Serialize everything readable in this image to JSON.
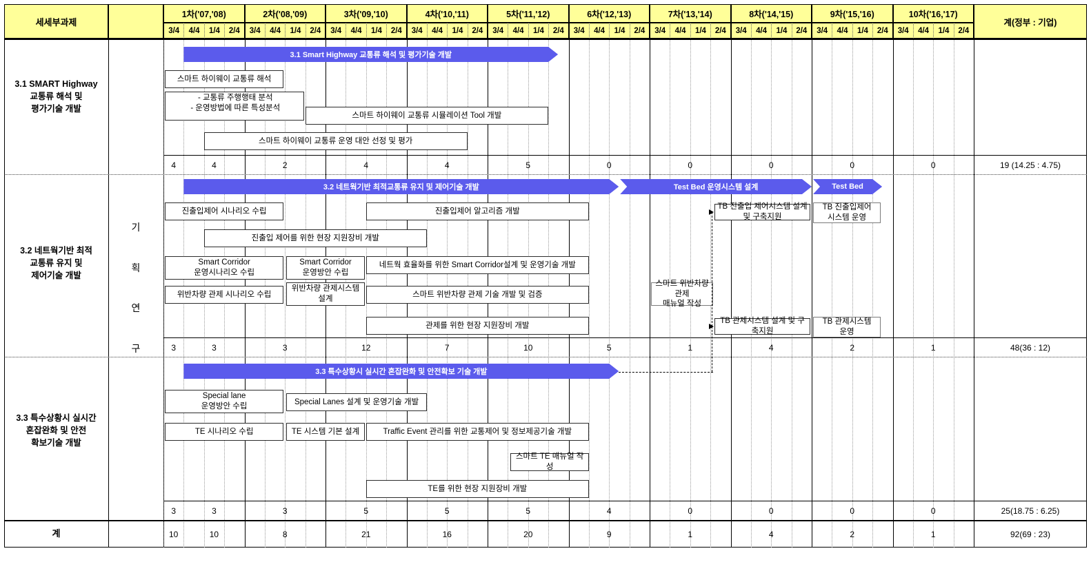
{
  "colors": {
    "header_bg": "#ffff99",
    "bar_blue": "#5b5bec",
    "box_bg": "#ffffff",
    "border": "#000000"
  },
  "header": {
    "task_column_label": "세세부과제",
    "total_column_label": "계(정부 : 기업)",
    "phases": [
      {
        "label": "1차('07,'08)",
        "quarters": [
          "3/4",
          "4/4",
          "1/4",
          "2/4"
        ]
      },
      {
        "label": "2차('08,'09)",
        "quarters": [
          "3/4",
          "4/4",
          "1/4",
          "2/4"
        ]
      },
      {
        "label": "3차('09,'10)",
        "quarters": [
          "3/4",
          "4/4",
          "1/4",
          "2/4"
        ]
      },
      {
        "label": "4차('10,'11)",
        "quarters": [
          "3/4",
          "4/4",
          "1/4",
          "2/4"
        ]
      },
      {
        "label": "5차('11,'12)",
        "quarters": [
          "3/4",
          "4/4",
          "1/4",
          "2/4"
        ]
      },
      {
        "label": "6차('12,'13)",
        "quarters": [
          "3/4",
          "4/4",
          "1/4",
          "2/4"
        ]
      },
      {
        "label": "7차('13,'14)",
        "quarters": [
          "3/4",
          "4/4",
          "1/4",
          "2/4"
        ]
      },
      {
        "label": "8차('14,'15)",
        "quarters": [
          "3/4",
          "4/4",
          "1/4",
          "2/4"
        ]
      },
      {
        "label": "9차('15,'16)",
        "quarters": [
          "3/4",
          "4/4",
          "1/4",
          "2/4"
        ]
      },
      {
        "label": "10차('16,'17)",
        "quarters": [
          "3/4",
          "4/4",
          "1/4",
          "2/4"
        ]
      }
    ]
  },
  "planning_research_label": "기 획 연 구",
  "rows": [
    {
      "name": "3.1 SMART Highway\n교통류 해석 및\n평가기술 개발",
      "name_lines": [
        "3.1 SMART Highway",
        "교통류 해석 및",
        "평가기술 개발"
      ],
      "milestone_bar": "3.1 Smart Highway 교통류 해석 및 평가기술 개발",
      "tasks": [
        "스마트 하이웨이 교통류 해석",
        "- 교통류 주행행태 분석\n- 운영방법에 따른 특성분석",
        "스마트 하이웨이 교통류 시뮬레이션 Tool 개발",
        "스마트 하이웨이 교통류 운영 대안 선정 및 평가"
      ],
      "task_lines": [
        [
          "스마트 하이웨이 교통류 해석"
        ],
        [
          "- 교통류 주행행태 분석",
          "- 운영방법에 따른 특성분석"
        ],
        [
          "스마트 하이웨이 교통류 시뮬레이션 Tool 개발"
        ],
        [
          "스마트 하이웨이 교통류 운영 대안 선정 및 평가"
        ]
      ],
      "phase_values": [
        "4",
        "2",
        "4",
        "4",
        "5",
        "0",
        "0",
        "0",
        "0",
        "0"
      ],
      "first_cell_value": "4",
      "total": "19 (14.25 : 4.75)"
    },
    {
      "name_lines": [
        "3.2 네트웍기반 최적",
        "교통류 유지 및",
        "제어기술  개발"
      ],
      "milestone_bars": [
        "3.2 네트웍기반 최적교통류 유지 및 제어기술 개발",
        "Test Bed 운영시스템 설계",
        "Test Bed"
      ],
      "task_lines": [
        [
          "진출입제어 시나리오 수립"
        ],
        [
          "진출입제어 알고리즘 개발"
        ],
        [
          "TB 진출입 제어시스템 설계 및 구축지원"
        ],
        [
          "TB 진출입제어",
          "시스템 운영"
        ],
        [
          "진출입 제어를 위한 현장 지원장비 개발"
        ],
        [
          "Smart Corridor",
          "운영시나리오 수립"
        ],
        [
          "Smart Corridor",
          "운영방안 수립"
        ],
        [
          "네트웍 효율화를 위한 Smart Corridor설계 및 운영기술 개발"
        ],
        [
          "위반차량 관제 시나리오 수립"
        ],
        [
          "위반차량 관제시스템",
          "설계"
        ],
        [
          "스마트 위반차량 관제 기술 개발 및 검증"
        ],
        [
          "스마트 위반차량 관제",
          "매뉴얼 작성"
        ],
        [
          "관제를 위한 현장 지원장비 개발"
        ],
        [
          "TB 관제시스템 설계 및 구축지원"
        ],
        [
          "TB 관제시스템",
          "운영"
        ]
      ],
      "phase_values": [
        "3",
        "3",
        "12",
        "7",
        "10",
        "5",
        "1",
        "4",
        "2",
        "1"
      ],
      "first_cell_value": "3",
      "total": "48(36 : 12)"
    },
    {
      "name_lines": [
        "3.3 특수상황시 실시간",
        "혼잡완화 및 안전",
        "확보기술 개발"
      ],
      "milestone_bar": "3.3 특수상황시 실시간 혼잡완화 및 안전확보 기술 개발",
      "task_lines": [
        [
          "Special lane",
          "운영방안 수립"
        ],
        [
          "Special Lanes 설계 및 운영기술 개발"
        ],
        [
          "TE 시나리오 수립"
        ],
        [
          "TE 시스템 기본 설계"
        ],
        [
          "Traffic Event 관리를 위한 교통제어 및 정보제공기술 개발"
        ],
        [
          "스마트 TE 매뉴얼 작성"
        ],
        [
          "TE를 위한 현장 지원장비 개발"
        ]
      ],
      "phase_values": [
        "3",
        "3",
        "5",
        "5",
        "5",
        "4",
        "0",
        "0",
        "0",
        "0"
      ],
      "first_cell_value": "3",
      "total": "25(18.75 : 6.25)"
    }
  ],
  "grand_total_row": {
    "label": "계",
    "first_cell_value": "10",
    "phase_values": [
      "10",
      "8",
      "21",
      "16",
      "20",
      "9",
      "1",
      "4",
      "2",
      "1"
    ],
    "total": "92(69 : 23)"
  }
}
